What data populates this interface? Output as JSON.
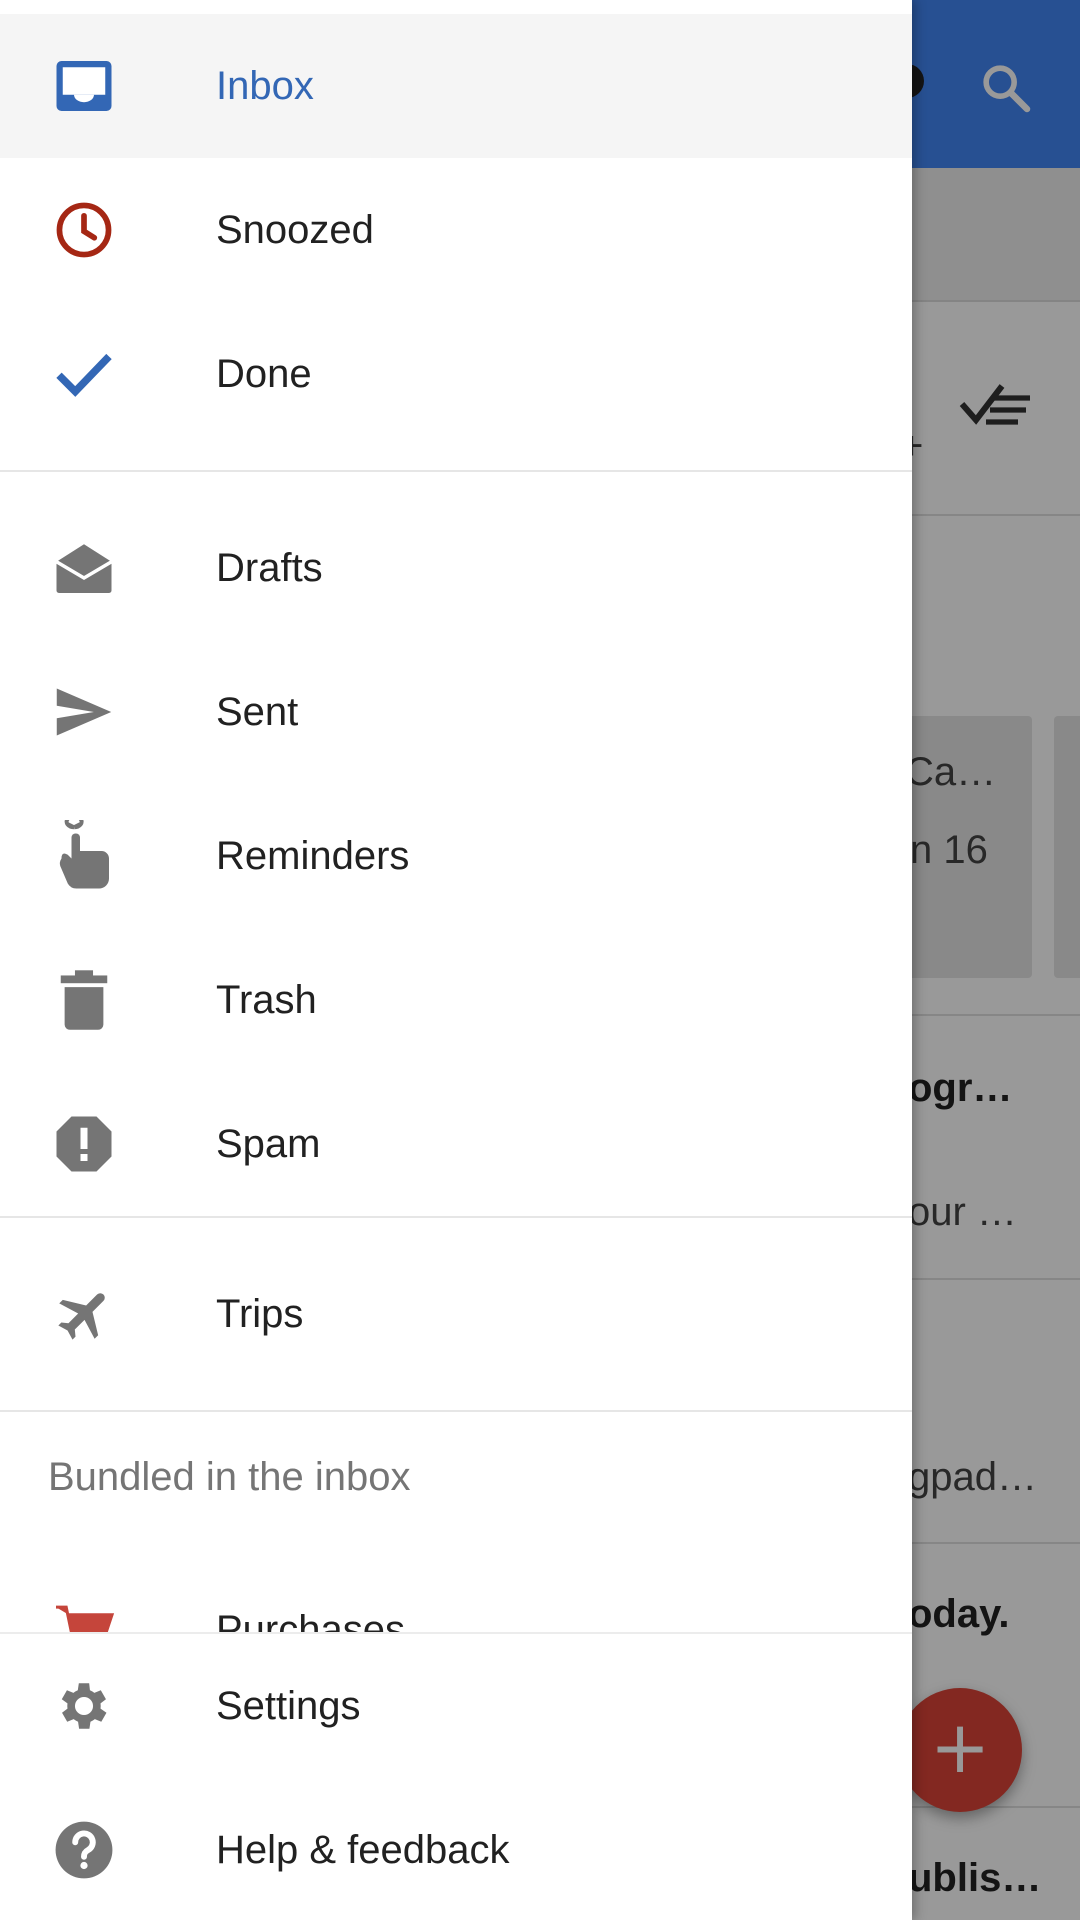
{
  "background": {
    "snippets": [
      {
        "text": "+",
        "bold": false
      },
      {
        "text": "Ca…",
        "bold": false
      },
      {
        "text": "n 16",
        "bold": false
      },
      {
        "text": "ogr…",
        "bold": true
      },
      {
        "text": "our …",
        "bold": false
      },
      {
        "text": "gpad…",
        "bold": false
      },
      {
        "text": "oday.",
        "bold": true
      },
      {
        "text": "ublis…",
        "bold": true
      }
    ],
    "fab_label": "+"
  },
  "drawer": {
    "primary": [
      {
        "label": "Inbox",
        "icon": "inbox-icon",
        "active": true
      },
      {
        "label": "Snoozed",
        "icon": "clock-icon"
      },
      {
        "label": "Done",
        "icon": "check-icon"
      }
    ],
    "secondary": [
      {
        "label": "Drafts",
        "icon": "envelope-open-icon"
      },
      {
        "label": "Sent",
        "icon": "send-icon"
      },
      {
        "label": "Reminders",
        "icon": "reminder-finger-icon"
      },
      {
        "label": "Trash",
        "icon": "trash-icon"
      },
      {
        "label": "Spam",
        "icon": "spam-icon"
      }
    ],
    "tertiary": [
      {
        "label": "Trips",
        "icon": "airplane-icon"
      }
    ],
    "bundled_header": "Bundled in the inbox",
    "bundled": [
      {
        "label": "Purchases",
        "icon": "cart-icon"
      }
    ],
    "footer": [
      {
        "label": "Settings",
        "icon": "gear-icon"
      },
      {
        "label": "Help & feedback",
        "icon": "help-icon"
      }
    ]
  },
  "colors": {
    "accent_blue": "#3367b5",
    "clock_red": "#a52714",
    "cart_red": "#c5453b",
    "icon_grey": "#757575",
    "topbar_blue": "#4285f4",
    "fab_red": "#db4437"
  }
}
